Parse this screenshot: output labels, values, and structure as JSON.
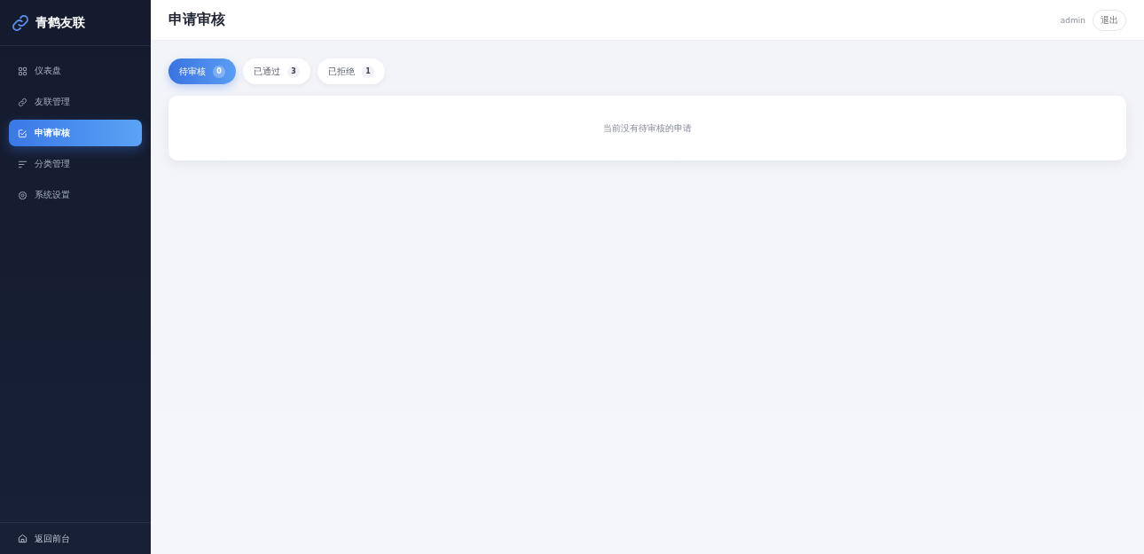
{
  "sidebar": {
    "brand": "青鹤友联",
    "items": [
      {
        "label": "仪表盘",
        "kind": "grid",
        "selected": false
      },
      {
        "label": "友联管理",
        "kind": "link",
        "selected": false
      },
      {
        "label": "申请审核",
        "kind": "edit",
        "selected": true
      },
      {
        "label": "分类管理",
        "kind": "list",
        "selected": false
      },
      {
        "label": "系统设置",
        "kind": "gear",
        "selected": false
      }
    ],
    "footer_link": "返回前台"
  },
  "header": {
    "title": "申请审核",
    "user": "admin",
    "logout_button": "退出"
  },
  "tabs": [
    {
      "label": "待审核",
      "count": "0",
      "selected": true
    },
    {
      "label": "已通过",
      "count": "3",
      "selected": false
    },
    {
      "label": "已拒绝",
      "count": "1",
      "selected": false
    }
  ],
  "empty_message": "当前没有待审核的申请"
}
